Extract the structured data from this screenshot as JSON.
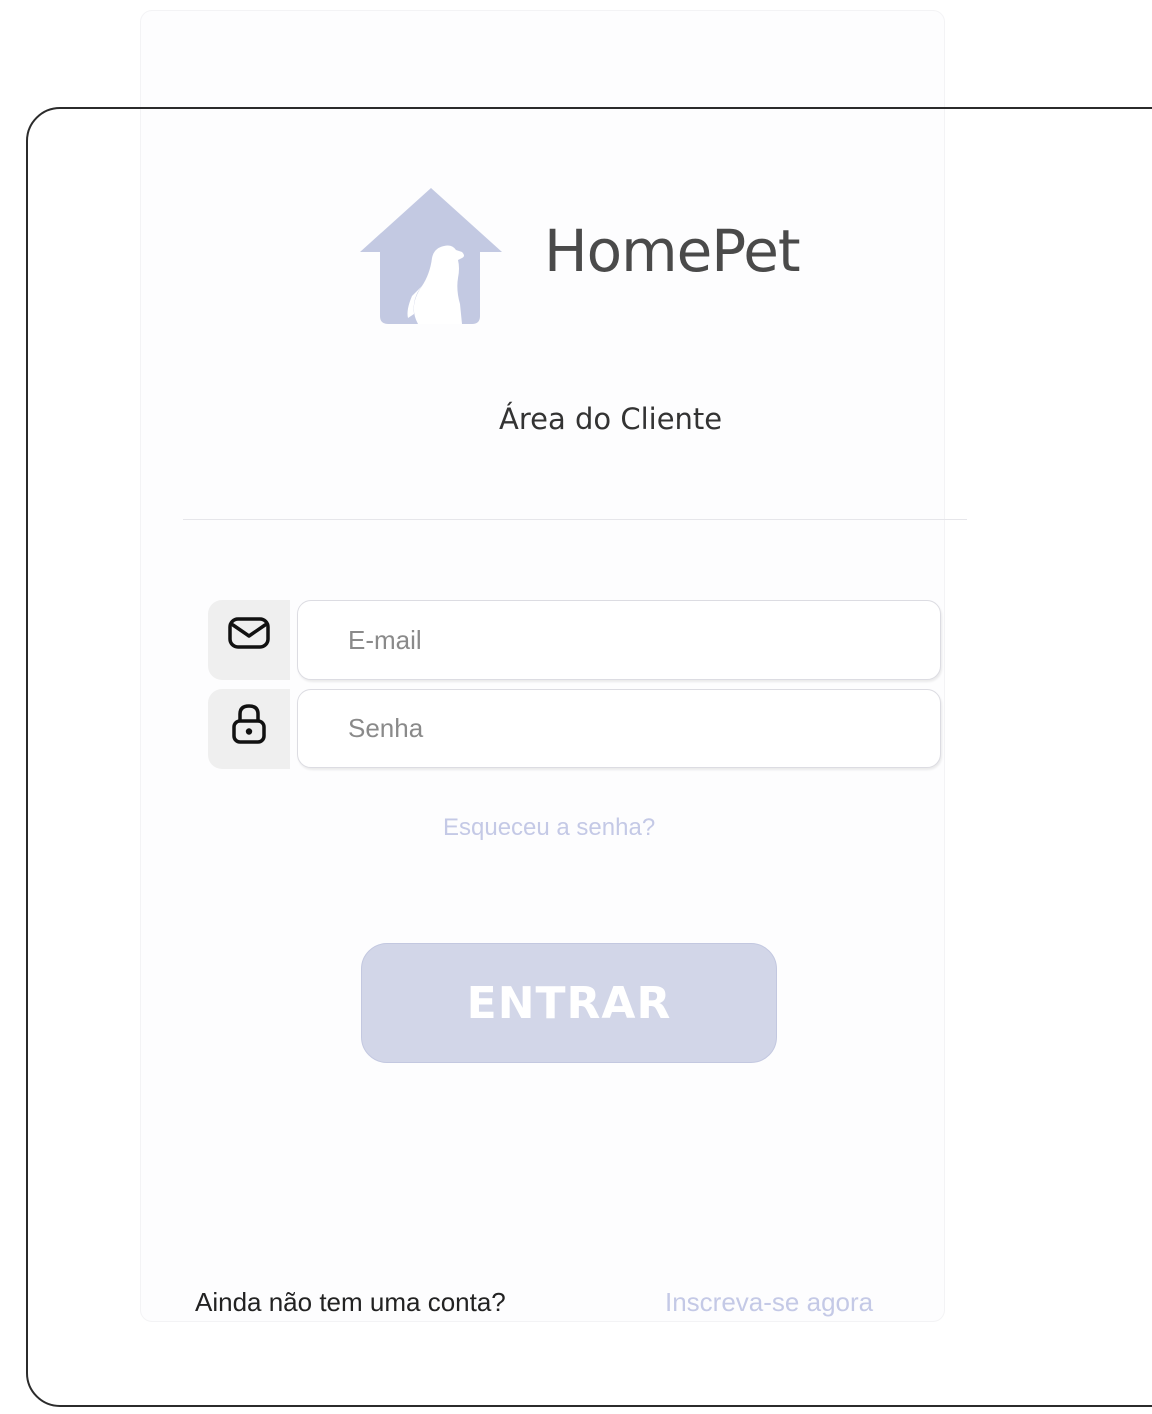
{
  "brand": {
    "name": "HomePet",
    "logo_icon": "house-with-dog-icon",
    "logo_color": "#c3c9e2"
  },
  "header": {
    "subtitle": "Área do Cliente"
  },
  "form": {
    "email": {
      "icon": "envelope-icon",
      "placeholder": "E-mail",
      "value": ""
    },
    "password": {
      "icon": "lock-icon",
      "placeholder": "Senha",
      "value": ""
    },
    "forgot_link": "Esqueceu a senha?",
    "submit_label": "ENTRAR"
  },
  "footer": {
    "prompt": "Ainda não tem uma conta?",
    "signup_link": "Inscreva-se agora"
  },
  "colors": {
    "accent": "#c4c9e6",
    "button": "#d2d6e8",
    "icon_bg": "#efefef"
  }
}
